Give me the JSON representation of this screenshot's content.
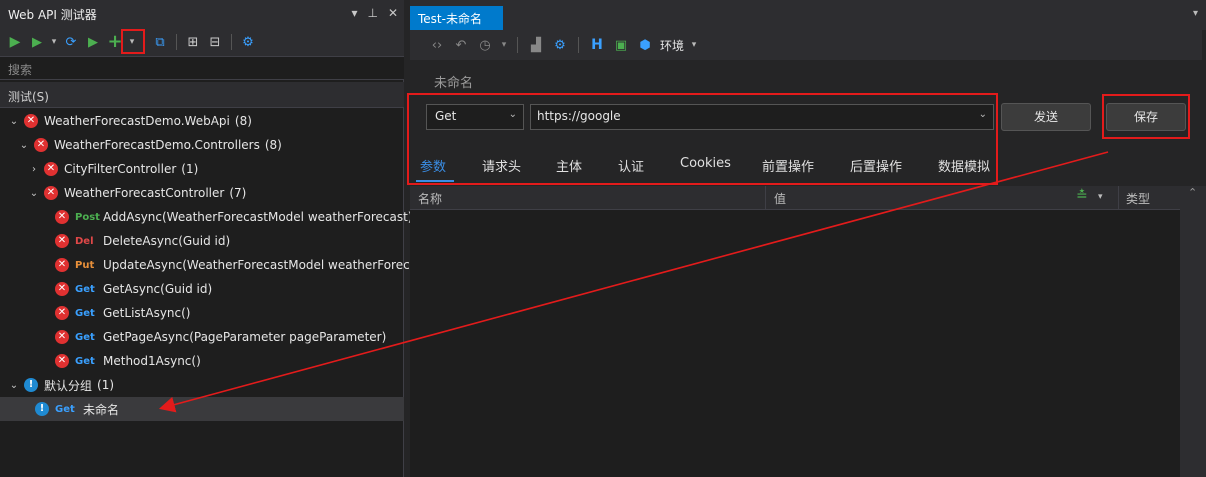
{
  "left_panel": {
    "title": "Web API 测试器",
    "title_icons": [
      "chevron-down-icon",
      "pin-icon",
      "close-icon"
    ],
    "toolbar": [
      {
        "name": "run-all-icon",
        "glyph": "▶"
      },
      {
        "name": "run-icon",
        "glyph": "▶"
      },
      {
        "name": "refresh-icon",
        "glyph": "⟳"
      },
      {
        "name": "run-stop-icon",
        "glyph": "▶"
      },
      {
        "name": "add-icon",
        "glyph": "+"
      },
      {
        "name": "hierarchy-icon",
        "glyph": "⊕"
      },
      {
        "name": "expand-icon",
        "glyph": "⊞"
      },
      {
        "name": "collapse-icon",
        "glyph": "⊟"
      },
      {
        "name": "gear-icon",
        "glyph": "⚙"
      }
    ],
    "search_placeholder": "搜索",
    "tests_header": "测试(S)",
    "tree": {
      "root": {
        "label": "WeatherForecastDemo.WebApi",
        "count": "(8)"
      },
      "controllers": {
        "label": "WeatherForecastDemo.Controllers",
        "count": "(8)"
      },
      "city": {
        "label": "CityFilterController",
        "count": "(1)"
      },
      "weather": {
        "label": "WeatherForecastController",
        "count": "(7)"
      },
      "methods": [
        {
          "method": "Post",
          "label": "AddAsync(WeatherForecastModel weatherForecast)"
        },
        {
          "method": "Del",
          "label": "DeleteAsync(Guid id)"
        },
        {
          "method": "Put",
          "label": "UpdateAsync(WeatherForecastModel weatherForecast)"
        },
        {
          "method": "Get",
          "label": "GetAsync(Guid id)"
        },
        {
          "method": "Get",
          "label": "GetListAsync()"
        },
        {
          "method": "Get",
          "label": "GetPageAsync(PageParameter pageParameter)"
        },
        {
          "method": "Get",
          "label": "Method1Async()"
        }
      ],
      "default_group": {
        "label": "默认分组",
        "count": "(1)"
      },
      "default_item": {
        "method": "Get",
        "label": "未命名"
      }
    }
  },
  "right_panel": {
    "tab_title": "Test-未命名",
    "toolbar_env_label": "环境",
    "request_name": "未命名",
    "method": "Get",
    "url": "https://google",
    "send_label": "发送",
    "save_label": "保存",
    "request_tabs": [
      "参数",
      "请求头",
      "主体",
      "认证",
      "Cookies",
      "前置操作",
      "后置操作",
      "数据模拟"
    ],
    "grid_headers": {
      "name": "名称",
      "value": "值",
      "type": "类型"
    }
  },
  "colors": {
    "accent": "#007acc",
    "error": "#e03131",
    "annotation": "#e31b1b",
    "post": "#4caf50",
    "del": "#e04848",
    "put": "#e8903a",
    "get": "#3aa0ff"
  }
}
